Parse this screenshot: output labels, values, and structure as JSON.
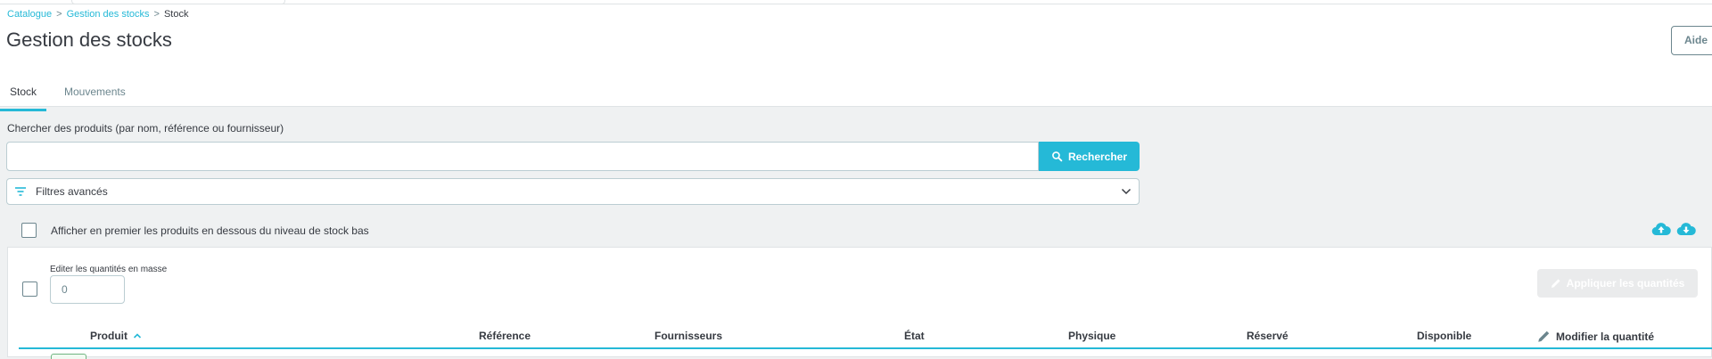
{
  "breadcrumb": {
    "items": [
      "Catalogue",
      "Gestion des stocks"
    ],
    "current": "Stock"
  },
  "header": {
    "title": "Gestion des stocks",
    "help_label": "Aide"
  },
  "tabs": [
    {
      "label": "Stock",
      "active": true
    },
    {
      "label": "Mouvements",
      "active": false
    }
  ],
  "search": {
    "label": "Chercher des produits (par nom, référence ou fournisseur)",
    "value": "",
    "placeholder": "",
    "button_label": "Rechercher"
  },
  "filters": {
    "label": "Filtres avancés"
  },
  "low_stock": {
    "label": "Afficher en premier les produits en dessous du niveau de stock bas",
    "checked": false
  },
  "icons": {
    "upload": "cloud-upload-icon",
    "download": "cloud-download-icon"
  },
  "bulk": {
    "label": "Editer les quantités en masse",
    "value": "0",
    "apply_label": "Appliquer les quantités"
  },
  "table": {
    "columns": [
      "Produit",
      "Référence",
      "Fournisseurs",
      "État",
      "Physique",
      "Réservé",
      "Disponible",
      "Modifier la quantité"
    ],
    "sort_column": "Produit",
    "sort_direction": "asc"
  },
  "colors": {
    "accent": "#25b9d7",
    "text": "#363a41",
    "muted": "#6c868e",
    "background": "#eff1f2",
    "disabled": "#eaebec"
  }
}
